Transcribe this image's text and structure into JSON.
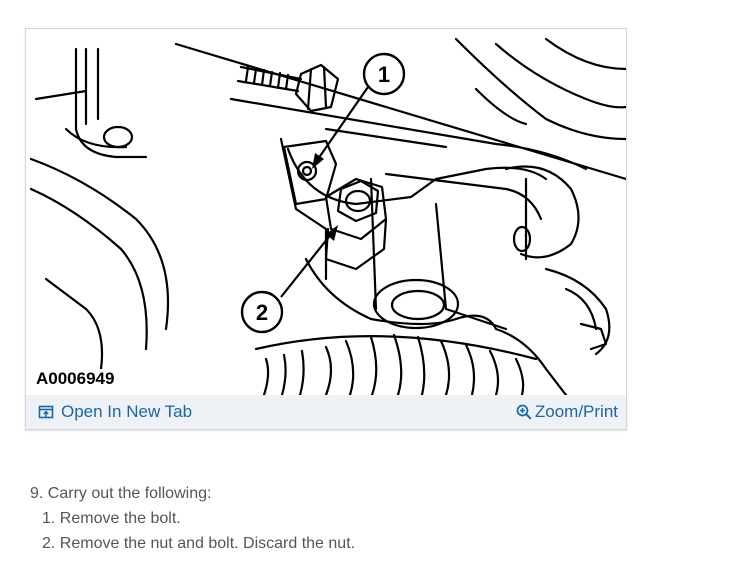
{
  "figure": {
    "id_label": "A0006949",
    "callouts": [
      "1",
      "2"
    ]
  },
  "toolbar": {
    "open_tab_label": "Open In New Tab",
    "zoom_print_label": "Zoom/Print",
    "open_tab_icon": "open-in-new-tab-icon",
    "zoom_icon": "zoom-in-icon"
  },
  "instructions": {
    "step_number": "9.",
    "step_text": "Carry out the following:",
    "substeps": [
      {
        "number": "1.",
        "text": "Remove the bolt."
      },
      {
        "number": "2.",
        "text": "Remove the nut and bolt. Discard the nut."
      }
    ]
  },
  "colors": {
    "link": "#1a66a8",
    "toolbar_bg": "#eef2f6",
    "card_border": "#cfd6de",
    "body_text": "#555555"
  }
}
